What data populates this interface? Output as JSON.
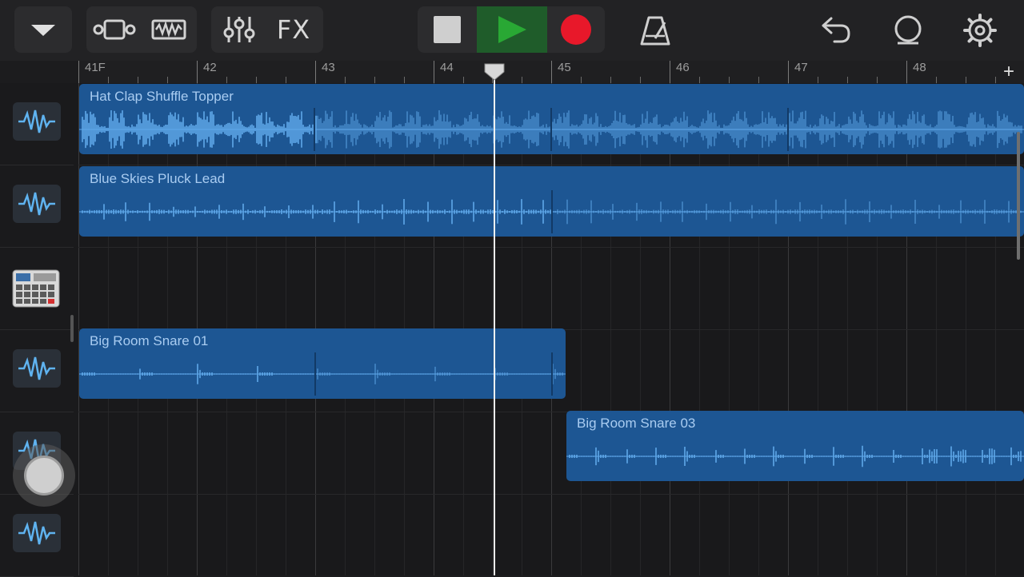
{
  "toolbar": {
    "view_menu_icon": "chevron-down-icon",
    "tracks_view_icon": "tracks-view-icon",
    "live_loops_icon": "live-loops-icon",
    "mixer_icon": "mixer-sliders-icon",
    "fx_label": "FX",
    "stop_icon": "stop-icon",
    "play_icon": "play-icon",
    "record_icon": "record-icon",
    "metronome_icon": "metronome-icon",
    "undo_icon": "undo-icon",
    "loop_browser_icon": "loop-icon",
    "settings_icon": "gear-icon",
    "colors": {
      "play_active": "#29a834",
      "play_bg": "#1f5c2a",
      "record": "#e8182a"
    }
  },
  "ruler": {
    "bars": [
      "41F",
      "42",
      "43",
      "44",
      "45",
      "46",
      "47",
      "48"
    ],
    "add_track_label": "+"
  },
  "tracks": [
    {
      "icon": "audio-waveform-icon",
      "region_label": "Hat Clap Shuffle Topper"
    },
    {
      "icon": "audio-waveform-icon",
      "region_label": "Blue Skies Pluck Lead"
    },
    {
      "icon": "drum-machine-icon"
    },
    {
      "icon": "audio-waveform-icon",
      "region_label": "Big Room Snare 01"
    },
    {
      "icon": "audio-waveform-icon",
      "region_label": "Big Room Snare 03"
    },
    {
      "icon": "audio-waveform-icon"
    }
  ],
  "colors": {
    "region": "#1d5693",
    "waveform": "#5fa8ea",
    "label": "#a9ccf1"
  }
}
